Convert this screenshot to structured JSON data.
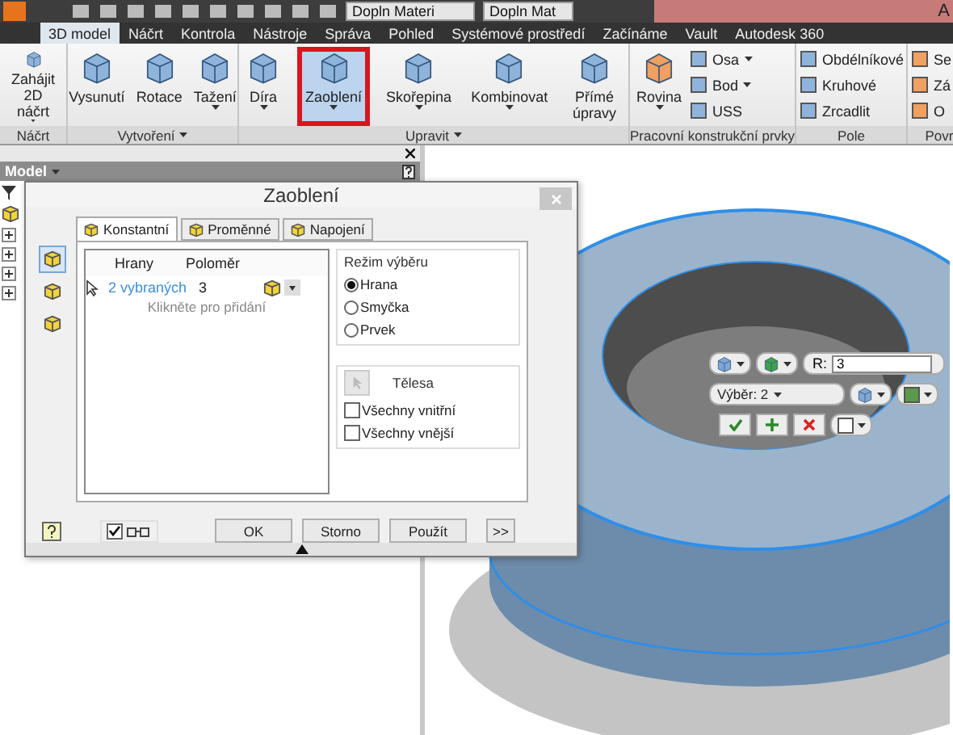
{
  "title_bar": {
    "fields": [
      "Dopln Materi",
      "Dopln Mat"
    ],
    "title": "A"
  },
  "ribbon_tabs": [
    {
      "label": "3D model",
      "selected": true
    },
    {
      "label": "Náčrt",
      "selected": false
    },
    {
      "label": "Kontrola",
      "selected": false
    },
    {
      "label": "Nástroje",
      "selected": false
    },
    {
      "label": "Správa",
      "selected": false
    },
    {
      "label": "Pohled",
      "selected": false
    },
    {
      "label": "Systémové prostředí",
      "selected": false
    },
    {
      "label": "Začínáme",
      "selected": false
    },
    {
      "label": "Vault",
      "selected": false
    },
    {
      "label": "Autodesk 360",
      "selected": false
    }
  ],
  "ribbon_panels": [
    {
      "label": "Náčrt",
      "menu": false,
      "large_tools": [
        {
          "label": "Zahájit\n2D náčrt",
          "selected": false,
          "menu": true
        }
      ]
    },
    {
      "label": "Vytvoření",
      "menu": true,
      "large_tools": [
        {
          "label": "Vysunutí",
          "selected": false,
          "menu": false
        },
        {
          "label": "Rotace",
          "selected": false,
          "menu": false
        },
        {
          "label": "Tažení",
          "selected": false,
          "menu": true
        }
      ]
    },
    {
      "label": "Upravit",
      "menu": true,
      "large_tools": [
        {
          "label": "Díra",
          "selected": false,
          "menu": true
        },
        {
          "label": "Zaoblení",
          "selected": true,
          "menu": true
        },
        {
          "label": "Skořepina",
          "selected": false,
          "menu": true
        },
        {
          "label": "Kombinovat",
          "selected": false,
          "menu": true
        },
        {
          "label": "Přímé úpravy",
          "selected": false,
          "menu": false
        }
      ]
    },
    {
      "label": "Pracovní konstrukční prvky",
      "menu": false,
      "large_tools": [
        {
          "label": "Rovina",
          "selected": false,
          "menu": true
        }
      ],
      "small_tools": [
        {
          "label": "Osa",
          "menu": true
        },
        {
          "label": "Bod",
          "menu": true
        },
        {
          "label": "USS",
          "menu": false
        }
      ]
    },
    {
      "label": "Pole",
      "menu": false,
      "small_tools": [
        {
          "label": "Obdélníkové",
          "menu": false
        },
        {
          "label": "Kruhové",
          "menu": false
        },
        {
          "label": "Zrcadlit",
          "menu": false
        }
      ]
    },
    {
      "label": "Povr",
      "menu": false,
      "small_tools": [
        {
          "label": "Se",
          "menu": false
        },
        {
          "label": "Zá",
          "menu": false
        },
        {
          "label": "O",
          "menu": false
        }
      ]
    }
  ],
  "browser": {
    "title": "Model",
    "tree": [
      {
        "expanded": false
      },
      {
        "expanded": false
      },
      {
        "expanded": false
      },
      {
        "expanded": false
      }
    ]
  },
  "dialog": {
    "title": "Zaoblení",
    "side_buttons": [
      {
        "selected": true
      },
      {
        "selected": false
      },
      {
        "selected": false
      }
    ],
    "tabs": [
      {
        "label": "Konstantní",
        "selected": true
      },
      {
        "label": "Proměnné",
        "selected": false
      },
      {
        "label": "Napojení",
        "selected": false
      }
    ],
    "columns": [
      "Hrany",
      "Poloměr"
    ],
    "rows": [
      {
        "edges": "2 vybraných",
        "radius": "3"
      }
    ],
    "add_hint": "Klikněte pro přidání",
    "selection_mode": {
      "label": "Režim výběru",
      "options": [
        {
          "label": "Hrana",
          "selected": true
        },
        {
          "label": "Smyčka",
          "selected": false
        },
        {
          "label": "Prvek",
          "selected": false
        }
      ]
    },
    "solids": {
      "label": "Tělesa",
      "checkboxes": [
        {
          "label": "Všechny vnitřní",
          "checked": false
        },
        {
          "label": "Všechny vnější",
          "checked": false
        }
      ]
    },
    "preview": {
      "checked": true
    },
    "buttons": [
      "OK",
      "Storno",
      "Použít",
      ">>"
    ]
  },
  "mini_toolbar": {
    "radius_label": "R:",
    "radius_value": "3",
    "selection": "Výběr: 2"
  }
}
